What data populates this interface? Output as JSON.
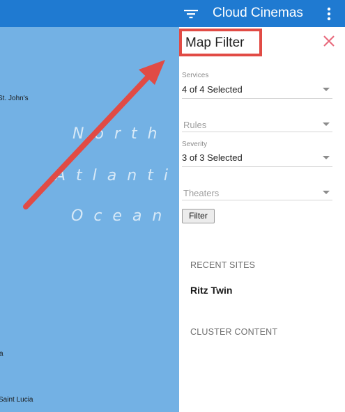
{
  "appbar": {
    "title": "Cloud Cinemas",
    "background": "#1f7ad1",
    "filter_icon": "filter-list-icon",
    "menu_icon": "more-vert-icon"
  },
  "map": {
    "labels": [
      "St. John's",
      "a",
      "Saint Lucia"
    ],
    "ocean_words": [
      "North",
      "Atlantic",
      "Ocean"
    ],
    "water_color": "#73b1e4"
  },
  "panel": {
    "title": "Map Filter",
    "close_icon": "close-icon",
    "highlight_color": "#e14b45",
    "fields": {
      "services": {
        "label": "Services",
        "value": "4 of 4 Selected"
      },
      "rules": {
        "placeholder": "Rules"
      },
      "severity": {
        "label": "Severity",
        "value": "3 of 3 Selected"
      },
      "theaters": {
        "placeholder": "Theaters"
      }
    },
    "filter_button": "Filter",
    "recent_sites": {
      "heading": "RECENT SITES",
      "items": [
        "Ritz Twin"
      ]
    },
    "cluster_content": {
      "heading": "CLUSTER CONTENT"
    }
  },
  "annotation": {
    "arrow_color": "#e14b45"
  }
}
